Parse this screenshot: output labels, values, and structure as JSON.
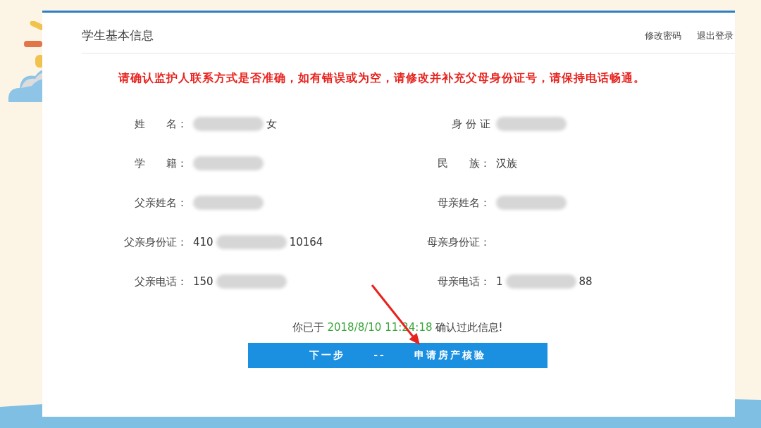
{
  "header": {
    "title": "学生基本信息",
    "links": [
      "修改密码",
      "退出登录"
    ]
  },
  "notice": "请确认监护人联系方式是否准确，如有错误或为空，请修改并补充父母身份证号，请保持电话畅通。",
  "fields": [
    {
      "label": "姓　　名：",
      "parts": [
        {
          "kind": "blur"
        },
        {
          "kind": "text",
          "text": "女"
        }
      ]
    },
    {
      "label": "身 份 证",
      "parts": [
        {
          "kind": "blur"
        }
      ]
    },
    {
      "label": "学　　籍：",
      "parts": [
        {
          "kind": "blur"
        }
      ]
    },
    {
      "label": "民　　族：",
      "parts": [
        {
          "kind": "text",
          "text": "汉族"
        }
      ]
    },
    {
      "label": "父亲姓名：",
      "parts": [
        {
          "kind": "blur"
        }
      ]
    },
    {
      "label": "母亲姓名：",
      "parts": [
        {
          "kind": "blur"
        }
      ]
    },
    {
      "label": "父亲身份证：",
      "parts": [
        {
          "kind": "text",
          "text": "410"
        },
        {
          "kind": "blur"
        },
        {
          "kind": "text",
          "text": "10164"
        }
      ]
    },
    {
      "label": "母亲身份证："
    },
    {
      "label": "父亲电话：",
      "parts": [
        {
          "kind": "text",
          "text": "150"
        },
        {
          "kind": "blur"
        }
      ]
    },
    {
      "label": "母亲电话：",
      "parts": [
        {
          "kind": "text",
          "text": "1"
        },
        {
          "kind": "blur"
        },
        {
          "kind": "text",
          "text": "88"
        }
      ]
    }
  ],
  "confirmation": {
    "prefix": "你已于",
    "timestamp": "2018/8/10 11:24:18",
    "suffix": "确认过此信息!"
  },
  "next_button": {
    "step": "下一步",
    "separator": "--",
    "action": "申请房产核验"
  }
}
